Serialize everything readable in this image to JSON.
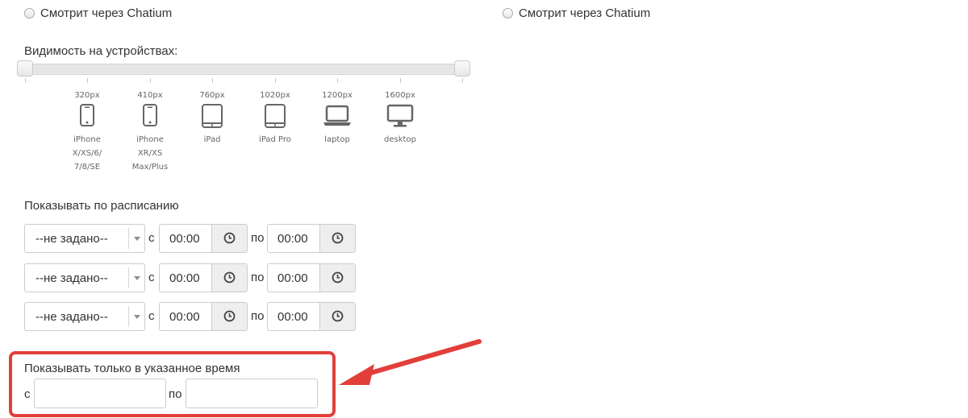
{
  "top_options": [
    {
      "label": "Смотрит через Chatium",
      "selected": false
    },
    {
      "label": "Смотрит через Chatium",
      "selected": false
    }
  ],
  "visibility": {
    "label": "Видимость на устройствах:",
    "range_min": 0,
    "range_max": 1,
    "devices": [
      {
        "px": "320px",
        "icon": "phone-icon",
        "name": "iPhone\nX/XS/6/\n7/8/SE"
      },
      {
        "px": "410px",
        "icon": "phone-icon",
        "name": "iPhone\nXR/XS\nMax/Plus"
      },
      {
        "px": "760px",
        "icon": "tablet-icon",
        "name": "iPad"
      },
      {
        "px": "1020px",
        "icon": "tablet-icon",
        "name": "iPad Pro"
      },
      {
        "px": "1200px",
        "icon": "laptop-icon",
        "name": "laptop"
      },
      {
        "px": "1600px",
        "icon": "desktop-icon",
        "name": "desktop"
      }
    ]
  },
  "schedule": {
    "label": "Показывать по расписанию",
    "from_word": "с",
    "to_word": "по",
    "rows": [
      {
        "day": "--не задано--",
        "from": "00:00",
        "to": "00:00"
      },
      {
        "day": "--не задано--",
        "from": "00:00",
        "to": "00:00"
      },
      {
        "day": "--не задано--",
        "from": "00:00",
        "to": "00:00"
      }
    ]
  },
  "time_only": {
    "label": "Показывать только в указанное время",
    "from_word": "с",
    "to_word": "по",
    "from_value": "",
    "to_value": ""
  },
  "colors": {
    "annotation": "#e23f3a"
  }
}
